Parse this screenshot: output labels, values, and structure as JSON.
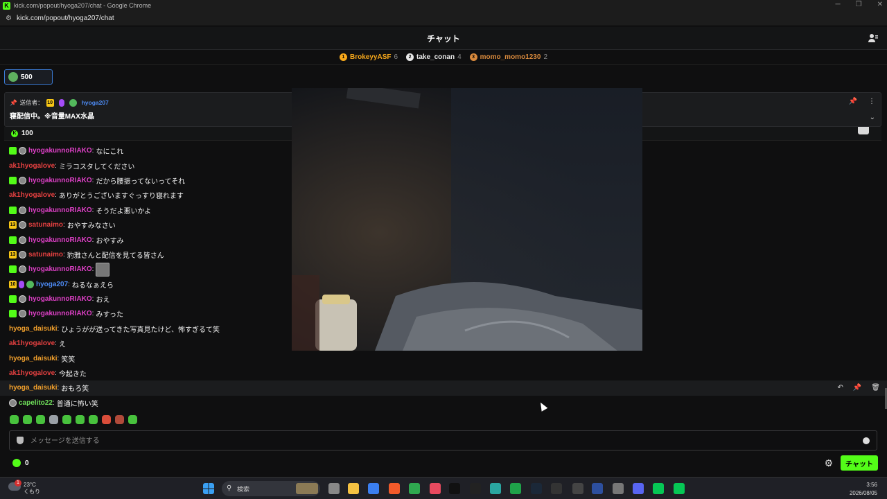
{
  "window": {
    "title": "kick.com/popout/hyoga207/chat - Google Chrome",
    "url": "kick.com/popout/hyoga207/chat"
  },
  "header": {
    "title": "チャット"
  },
  "leaderboard": [
    {
      "rank": "1",
      "name": "BrokeyyASF",
      "count": "6",
      "color": "#f7a81b"
    },
    {
      "rank": "2",
      "name": "take_conan",
      "count": "4",
      "color": "#e8e8e8"
    },
    {
      "rank": "3",
      "name": "momo_momo1230",
      "count": "2",
      "color": "#d98a3d"
    }
  ],
  "goal": {
    "value": "500"
  },
  "pinned": {
    "sender_label": "送信者：",
    "sub_months": "10",
    "username": "hyoga207",
    "message": "寝配信中。※音量MAX水晶"
  },
  "kicks_bar": {
    "value": "100"
  },
  "chat": [
    {
      "badges": [
        "gift",
        "avatar"
      ],
      "user": "hyogakunnoRIAKO",
      "color": "#e040c8",
      "text": "なにこれ"
    },
    {
      "badges": [],
      "user": "ak1hyogalove",
      "color": "#e84141",
      "text": "ミラコスタしてください"
    },
    {
      "badges": [
        "gift",
        "avatar"
      ],
      "user": "hyogakunnoRIAKO",
      "color": "#e040c8",
      "text": "だから腰振ってないってそれ"
    },
    {
      "badges": [],
      "user": "ak1hyogalove",
      "color": "#e84141",
      "text": "ありがとうございますぐっすり寝れます"
    },
    {
      "badges": [
        "gift",
        "avatar"
      ],
      "user": "hyogakunnoRIAKO",
      "color": "#e040c8",
      "text": "そうだよ悪いかよ"
    },
    {
      "badges": [
        "sub13",
        "avatar"
      ],
      "user": "satunaimo",
      "color": "#e84141",
      "text": "おやすみなさい"
    },
    {
      "badges": [
        "gift",
        "avatar"
      ],
      "user": "hyogakunnoRIAKO",
      "color": "#e040c8",
      "text": "おやすみ"
    },
    {
      "badges": [
        "sub13",
        "avatar"
      ],
      "user": "satunaimo",
      "color": "#e84141",
      "text": "豹雅さんと配信を見てる皆さん"
    },
    {
      "badges": [
        "gift",
        "avatar"
      ],
      "user": "hyogakunnoRIAKO",
      "color": "#e040c8",
      "text": "",
      "emote": true
    },
    {
      "badges": [
        "sub10",
        "mic",
        "verified"
      ],
      "user": "hyoga207",
      "color": "#4d8bf5",
      "text": "ねるなぁえら"
    },
    {
      "badges": [
        "gift",
        "avatar"
      ],
      "user": "hyogakunnoRIAKO",
      "color": "#e040c8",
      "text": "おえ"
    },
    {
      "badges": [
        "gift",
        "avatar"
      ],
      "user": "hyogakunnoRIAKO",
      "color": "#e040c8",
      "text": "みすった"
    },
    {
      "badges": [],
      "user": "hyoga_daisuki",
      "color": "#f2a02c",
      "text": "ひょうがが送ってきた写真見たけど、怖すぎるて笑"
    },
    {
      "badges": [],
      "user": "ak1hyogalove",
      "color": "#e84141",
      "text": "え"
    },
    {
      "badges": [],
      "user": "hyoga_daisuki",
      "color": "#f2a02c",
      "text": "笑笑"
    },
    {
      "badges": [],
      "user": "ak1hyogalove",
      "color": "#e84141",
      "text": "今起きた"
    },
    {
      "badges": [],
      "user": "hyoga_daisuki",
      "color": "#f2a02c",
      "text": "おもろ笑",
      "highlight": true
    },
    {
      "badges": [
        "avatar"
      ],
      "user": "capelito22",
      "color": "#6fe05a",
      "text": "普通に怖い笑"
    }
  ],
  "input": {
    "placeholder": "メッセージを送信する"
  },
  "bottom": {
    "kicks": "0",
    "send_label": "チャット"
  },
  "taskbar": {
    "weather_temp": "23°C",
    "weather_desc": "くもり",
    "weather_badge": "1",
    "search_label": "検索",
    "time": "3:56",
    "date": "2026/08/05"
  }
}
